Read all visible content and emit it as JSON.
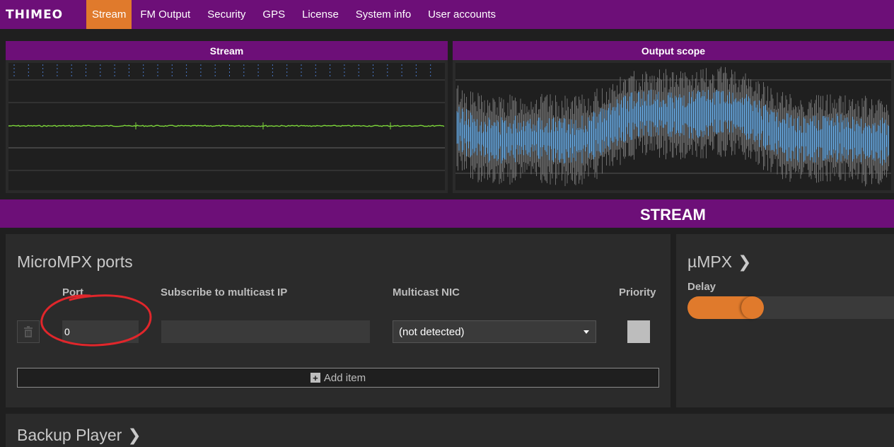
{
  "app": {
    "logo": "THIMEO"
  },
  "nav": {
    "items": [
      {
        "label": "Stream",
        "active": true
      },
      {
        "label": "FM Output",
        "active": false
      },
      {
        "label": "Security",
        "active": false
      },
      {
        "label": "GPS",
        "active": false
      },
      {
        "label": "License",
        "active": false
      },
      {
        "label": "System info",
        "active": false
      },
      {
        "label": "User accounts",
        "active": false
      }
    ]
  },
  "panels": {
    "stream_title": "Stream",
    "scope_title": "Output scope"
  },
  "section": {
    "title": "STREAM"
  },
  "micromp_card": {
    "title": "MicroMPX ports",
    "columns": {
      "port": "Port",
      "subscribe": "Subscribe to multicast IP",
      "nic": "Multicast NIC",
      "priority": "Priority"
    },
    "row": {
      "port_value": "0",
      "subscribe_value": "",
      "nic_value": "(not detected)"
    },
    "add_item_label": "Add item"
  },
  "umpx_card": {
    "title": "µMPX",
    "delay_label": "Delay",
    "delay_level_fraction": 0.13
  },
  "backup_card": {
    "title": "Backup Player"
  },
  "colors": {
    "brand_purple": "#6d0f78",
    "accent_orange": "#e07a2c",
    "annotation_red": "#e0262b"
  }
}
